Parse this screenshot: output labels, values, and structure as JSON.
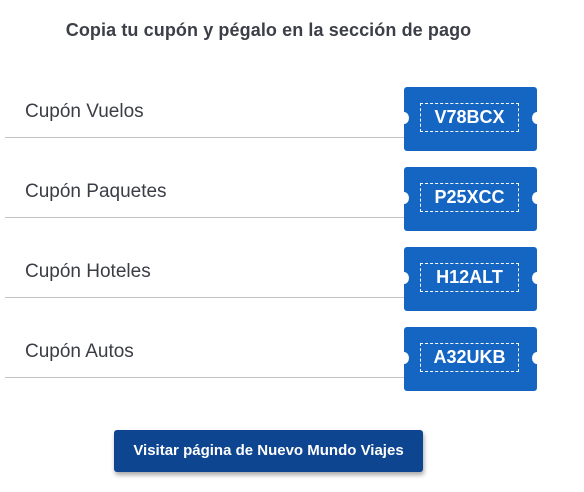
{
  "header": {
    "title": "Copia tu cupón y pégalo en la sección de pago"
  },
  "coupons": [
    {
      "label": "Cupón Vuelos",
      "code": "V78BCX"
    },
    {
      "label": "Cupón Paquetes",
      "code": "P25XCC"
    },
    {
      "label": "Cupón Hoteles",
      "code": "H12ALT"
    },
    {
      "label": "Cupón Autos",
      "code": "A32UKB"
    }
  ],
  "cta": {
    "label": "Visitar página de Nuevo Mundo Viajes"
  },
  "colors": {
    "coupon_blue": "#1466c2",
    "button_navy": "#0d4590",
    "text_dark": "#3a3d44"
  }
}
